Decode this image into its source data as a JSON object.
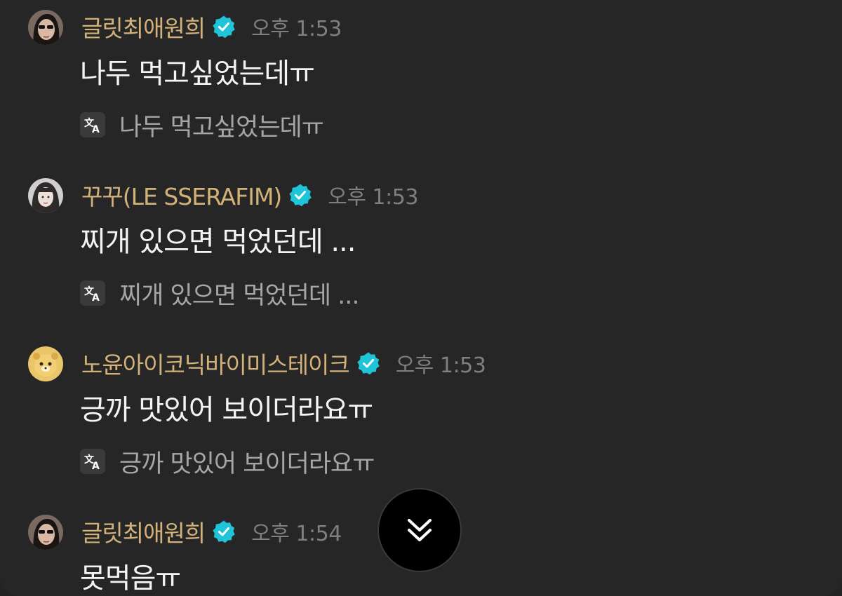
{
  "messages": [
    {
      "name": "글릿최애원희",
      "time": "오후 1:53",
      "text": "나두 먹고싶었는데ㅠ",
      "translation": "나두 먹고싶었는데ㅠ",
      "avatar": "avatar-sunglasses",
      "verified": true
    },
    {
      "name": "꾸꾸(LE SSERAFIM)",
      "time": "오후 1:53",
      "text": "찌개 있으면 먹었던데 ...",
      "translation": "찌개 있으면 먹었던데 ...",
      "avatar": "avatar-portrait",
      "verified": true
    },
    {
      "name": "노윤아이코닉바이미스테이크",
      "time": "오후 1:53",
      "text": "긍까 맛있어 보이더라요ㅠ",
      "translation": "긍까 맛있어 보이더라요ㅠ",
      "avatar": "avatar-character",
      "verified": true
    },
    {
      "name": "글릿최애원희",
      "time": "오후 1:54",
      "text": "못먹음ㅠ",
      "avatar": "avatar-sunglasses",
      "verified": true
    }
  ],
  "colors": {
    "background": "#262626",
    "name": "#d3b27a",
    "time": "#7f7f7f",
    "message_text": "#f4f4f4",
    "translation_text": "#a6a6a6",
    "verified_badge": "#20c4d8"
  },
  "icons": {
    "verified": "verified-badge-icon",
    "translate": "translate-icon",
    "scroll_down": "double-chevron-down-icon"
  }
}
